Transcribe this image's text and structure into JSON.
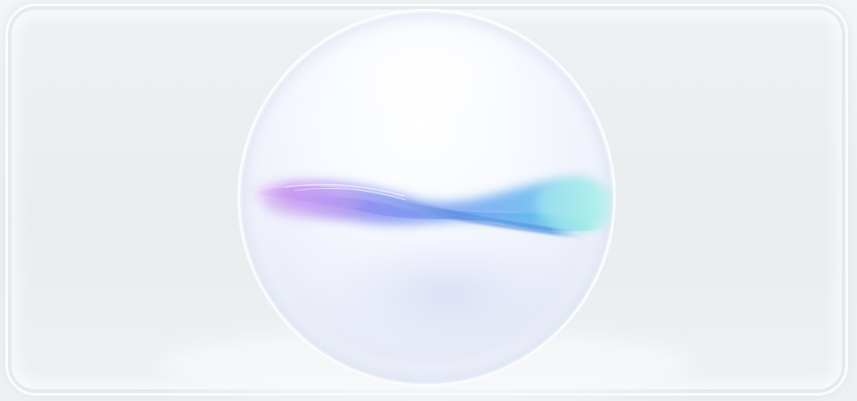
{
  "scene": {
    "subject": "sphere-wave-graphic",
    "colors": {
      "background": "#eef1f4",
      "sphere_highlight": "#ffffff",
      "wave_violet": "#c58df0",
      "wave_purple": "#8d8cf0",
      "wave_blue": "#5aa0ec",
      "wave_cyan": "#9fece8"
    }
  }
}
